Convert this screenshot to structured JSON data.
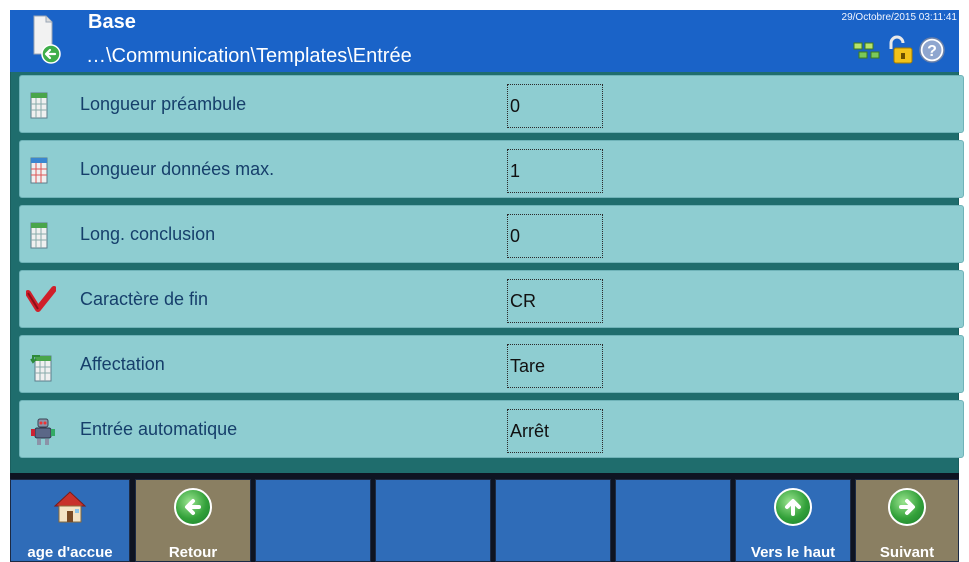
{
  "header": {
    "title": "Base",
    "path": "…\\Communication\\Templates\\Entrée",
    "datetime": "29/Octobre/2015 03:11:41"
  },
  "rows": [
    {
      "label": "Longueur préambule",
      "value": "0",
      "icon": "spreadsheet-icon"
    },
    {
      "label": "Longueur données max.",
      "value": "1",
      "icon": "spreadsheet-red-icon"
    },
    {
      "label": "Long. conclusion",
      "value": "0",
      "icon": "spreadsheet-icon"
    },
    {
      "label": "Caractère de fin",
      "value": "CR",
      "icon": "checkmark-icon"
    },
    {
      "label": "Affectation",
      "value": "Tare",
      "icon": "spreadsheet-arrow-icon"
    },
    {
      "label": "Entrée automatique",
      "value": "Arrêt",
      "icon": "robot-icon"
    }
  ],
  "softkeys": [
    {
      "label": "age d'accue",
      "icon": "home-icon"
    },
    {
      "label": "Retour",
      "icon": "arrow-left-icon"
    },
    {
      "label": "",
      "icon": ""
    },
    {
      "label": "",
      "icon": ""
    },
    {
      "label": "",
      "icon": ""
    },
    {
      "label": "",
      "icon": ""
    },
    {
      "label": "Vers le haut",
      "icon": "arrow-up-icon"
    },
    {
      "label": "Suivant",
      "icon": "arrow-right-icon"
    }
  ],
  "colors": {
    "header_bg": "#1a63c8",
    "row_bg": "#8ecdd1",
    "list_bg": "#1f6d6d",
    "softkey_blue": "#2f6cb8",
    "softkey_tan": "#8a7f62"
  }
}
